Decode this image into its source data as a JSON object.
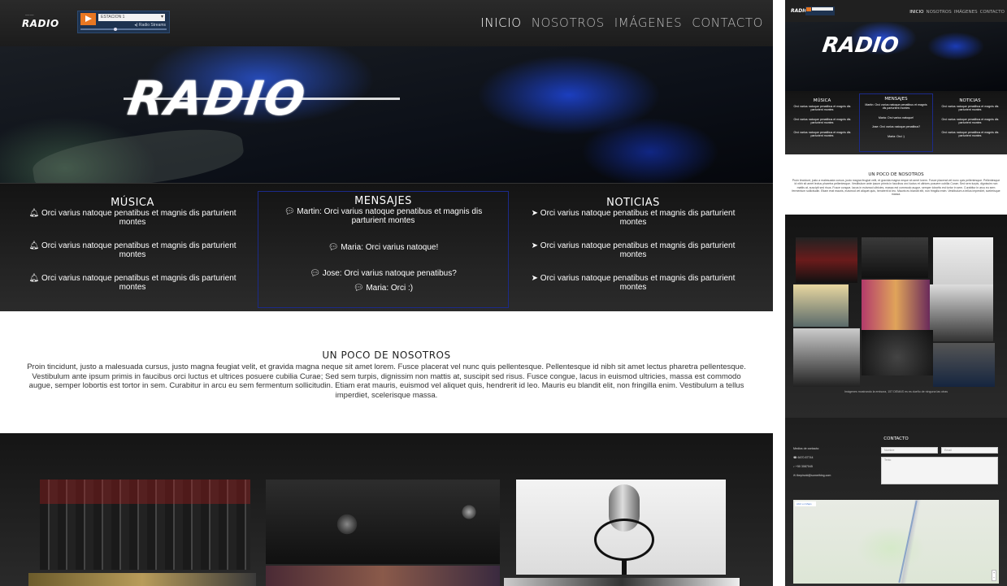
{
  "brand": {
    "logo_tagline": "——",
    "logo_word": "RADIO",
    "hero_logo": "RADIO"
  },
  "player": {
    "station": "ESTACION 1",
    "stream_label": "Radio Streams",
    "progress": 0.4
  },
  "nav": {
    "items": [
      {
        "label": "INICIO",
        "active": true
      },
      {
        "label": "NOSOTROS",
        "active": false
      },
      {
        "label": "IMÁGENES",
        "active": false
      },
      {
        "label": "CONTACTO",
        "active": false
      }
    ]
  },
  "columns": {
    "musica": {
      "title": "MÚSICA",
      "icon": "bell-icon",
      "items": [
        "Orci varius natoque penatibus et magnis dis parturient montes",
        "Orci varius natoque penatibus et magnis dis parturient montes",
        "Orci varius natoque penatibus et magnis dis parturient montes"
      ]
    },
    "mensajes": {
      "title": "MENSAJES",
      "icon": "comment-icon",
      "items": [
        "Martin: Orci varius natoque penatibus et magnis dis parturient montes",
        "Maria: Orci varius natoque!",
        "Jose: Orci varius natoque penatibus?",
        "Maria: Orci :)"
      ]
    },
    "noticias": {
      "title": "NOTICIAS",
      "icon": "paper-plane-icon",
      "items": [
        "Orci varius natoque penatibus et magnis dis parturient montes",
        "Orci varius natoque penatibus et magnis dis parturient montes",
        "Orci varius natoque penatibus et magnis dis parturient montes"
      ]
    }
  },
  "about": {
    "title": "UN POCO DE NOSOTROS",
    "body": "Proin tincidunt, justo a malesuada cursus, justo magna feugiat velit, et gravida magna neque sit amet lorem. Fusce placerat vel nunc quis pellentesque. Pellentesque id nibh sit amet lectus pharetra pellentesque. Vestibulum ante ipsum primis in faucibus orci luctus et ultrices posuere cubilia Curae; Sed sem turpis, dignissim non mattis at, suscipit sed risus. Fusce congue, lacus in euismod ultricies, massa est commodo augue, semper lobortis est tortor in sem. Curabitur in arcu eu sem fermentum sollicitudin. Etiam erat mauris, euismod vel aliquet quis, hendrerit id leo. Mauris eu blandit elit, non fringilla enim. Vestibulum a tellus imperdiet, scelerisque massa."
  },
  "mobile": {
    "nav": [
      "INICIO",
      "NOSOTROS",
      "IMÁGENES",
      "CONTACTO"
    ],
    "columns": [
      {
        "title": "MÚSICA",
        "items": [
          "Orci varius natoque penatibus et magnis dis parturient montes",
          "Orci varius natoque penatibus et magnis dis parturient montes",
          "Orci varius natoque penatibus et magnis dis parturient montes"
        ]
      },
      {
        "title": "MENSAJES",
        "items": [
          "Martin: Orci varius natoque penatibus et magnis dis parturient montes",
          "Maria: Orci varius natoque!",
          "Jose: Orci varius natoque penatibus?",
          "Maria: Orci :)"
        ]
      },
      {
        "title": "NOTICIAS",
        "items": [
          "Orci varius natoque penatibus et magnis dis parturient montes",
          "Orci varius natoque penatibus et magnis dis parturient montes",
          "Orci varius natoque penatibus et magnis dis parturient montes"
        ]
      }
    ],
    "gallery_caption": "Imágenes mostrando la emisora, 157 DEMAS es es dueño de ninguna las otras",
    "contact": {
      "title": "CONTACTO",
      "info_label": "Medios de contacto:",
      "phone1": "6470 87744",
      "phone2": "+50 3087045",
      "email": "thepinvid@something.com",
      "name_placeholder": "Nombre",
      "email_placeholder": "Email",
      "message_placeholder": "Texto",
      "map_badge": "Abrir en Maps"
    }
  },
  "colors": {
    "accent_orange": "#e87722",
    "mensajes_border": "#1b2a8a",
    "topbar": "#202020"
  }
}
